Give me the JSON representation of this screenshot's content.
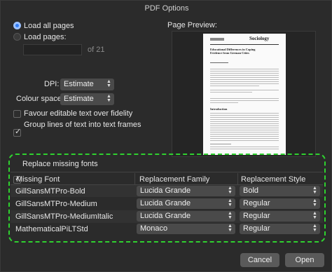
{
  "window": {
    "title": "PDF Options"
  },
  "pages": {
    "load_all_label": "Load all pages",
    "load_pages_label": "Load pages:",
    "of_label": "of 21",
    "pages_input_value": ""
  },
  "dpi": {
    "label": "DPI:",
    "value": "Estimate"
  },
  "colour_space": {
    "label": "Colour space:",
    "value": "Estimate"
  },
  "options": {
    "favour_editable_label": "Favour editable text over fidelity",
    "favour_editable_checked": false,
    "group_lines_label": "Group lines of text into text frames",
    "group_lines_checked": true
  },
  "preview": {
    "label": "Page Preview:",
    "heading": "Sociology",
    "title": "Educational Differences in Coping Evidence from German Cities",
    "intro": "Introduction"
  },
  "fonts": {
    "replace_label": "Replace missing fonts",
    "replace_checked": true,
    "headers": [
      "Missing Font",
      "Replacement Family",
      "Replacement Style"
    ],
    "rows": [
      {
        "missing": "GillSansMTPro-Bold",
        "family": "Lucida Grande",
        "style": "Bold"
      },
      {
        "missing": "GillSansMTPro-Medium",
        "family": "Lucida Grande",
        "style": "Regular"
      },
      {
        "missing": "GillSansMTPro-MediumItalic",
        "family": "Lucida Grande",
        "style": "Regular"
      },
      {
        "missing": "MathematicalPiLTStd",
        "family": "Monaco",
        "style": "Regular"
      }
    ]
  },
  "buttons": {
    "cancel": "Cancel",
    "open": "Open"
  },
  "colors": {
    "accent": "#2f7cf6",
    "highlight": "#2fd12f",
    "background": "#2b2b2b"
  }
}
